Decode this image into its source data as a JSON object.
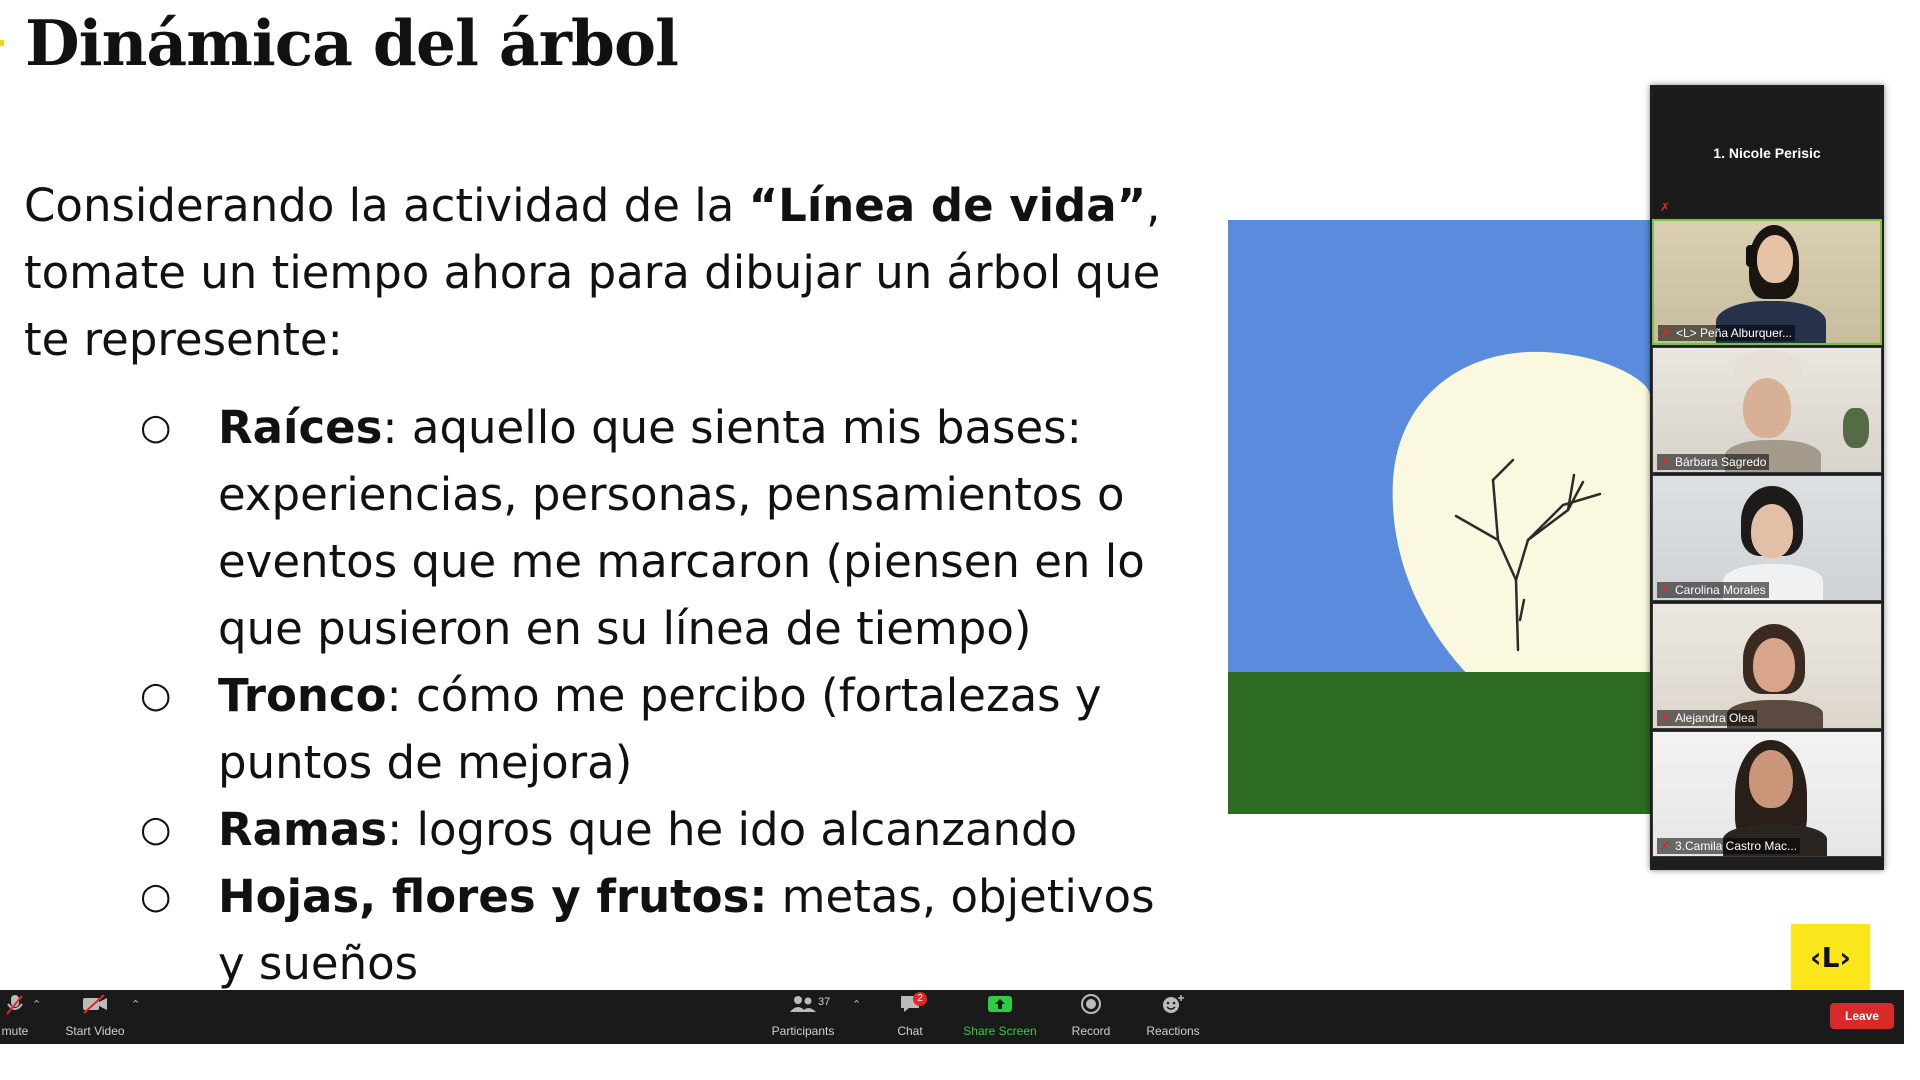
{
  "slide": {
    "title": "Dinámica del árbol",
    "intro": {
      "pre": "Considerando la actividad de la ",
      "bold": "“Línea de vida”",
      "post": ", tomate un tiempo ahora para dibujar un árbol que te represente:"
    },
    "bullet_symbol": "○",
    "bullets": [
      {
        "bold": "Raíces",
        "text": ": aquello que sienta mis bases: experiencias, personas, pensamientos o eventos que me marcaron (piensen en lo que pusieron en su línea de tiempo)"
      },
      {
        "bold": "Tronco",
        "text": ": cómo me percibo (fortalezas y puntos de mejora)"
      },
      {
        "bold": "Ramas",
        "text": ": logros que he ido alcanzando"
      },
      {
        "bold": "Hojas, flores y frutos:",
        "text": " metas, objetivos y sueños"
      }
    ],
    "logo_text": "‹L›"
  },
  "gallery": {
    "host": "1. Nicole Perisic",
    "participants": [
      {
        "label": "<L> Peña Alburquer...",
        "active": true
      },
      {
        "label": "Bárbara Sagredo",
        "active": false
      },
      {
        "label": "Carolina Morales",
        "active": false
      },
      {
        "label": "Alejandra Olea",
        "active": false
      },
      {
        "label": "3.Camila Castro Mac...",
        "active": false
      }
    ]
  },
  "toolbar": {
    "mute": "mute",
    "start_video": "Start Video",
    "participants_label": "Participants",
    "participants_count": "37",
    "chat": "Chat",
    "chat_badge": "2",
    "share_screen": "Share Screen",
    "record": "Record",
    "reactions": "Reactions",
    "leave": "Leave"
  },
  "colors": {
    "sky": "#5b8bdc",
    "grass": "#2e6b22",
    "crown": "#fbf8e0",
    "share_green": "#2ecc40",
    "leave_red": "#d92929",
    "brand_yellow": "#fbe51b"
  }
}
